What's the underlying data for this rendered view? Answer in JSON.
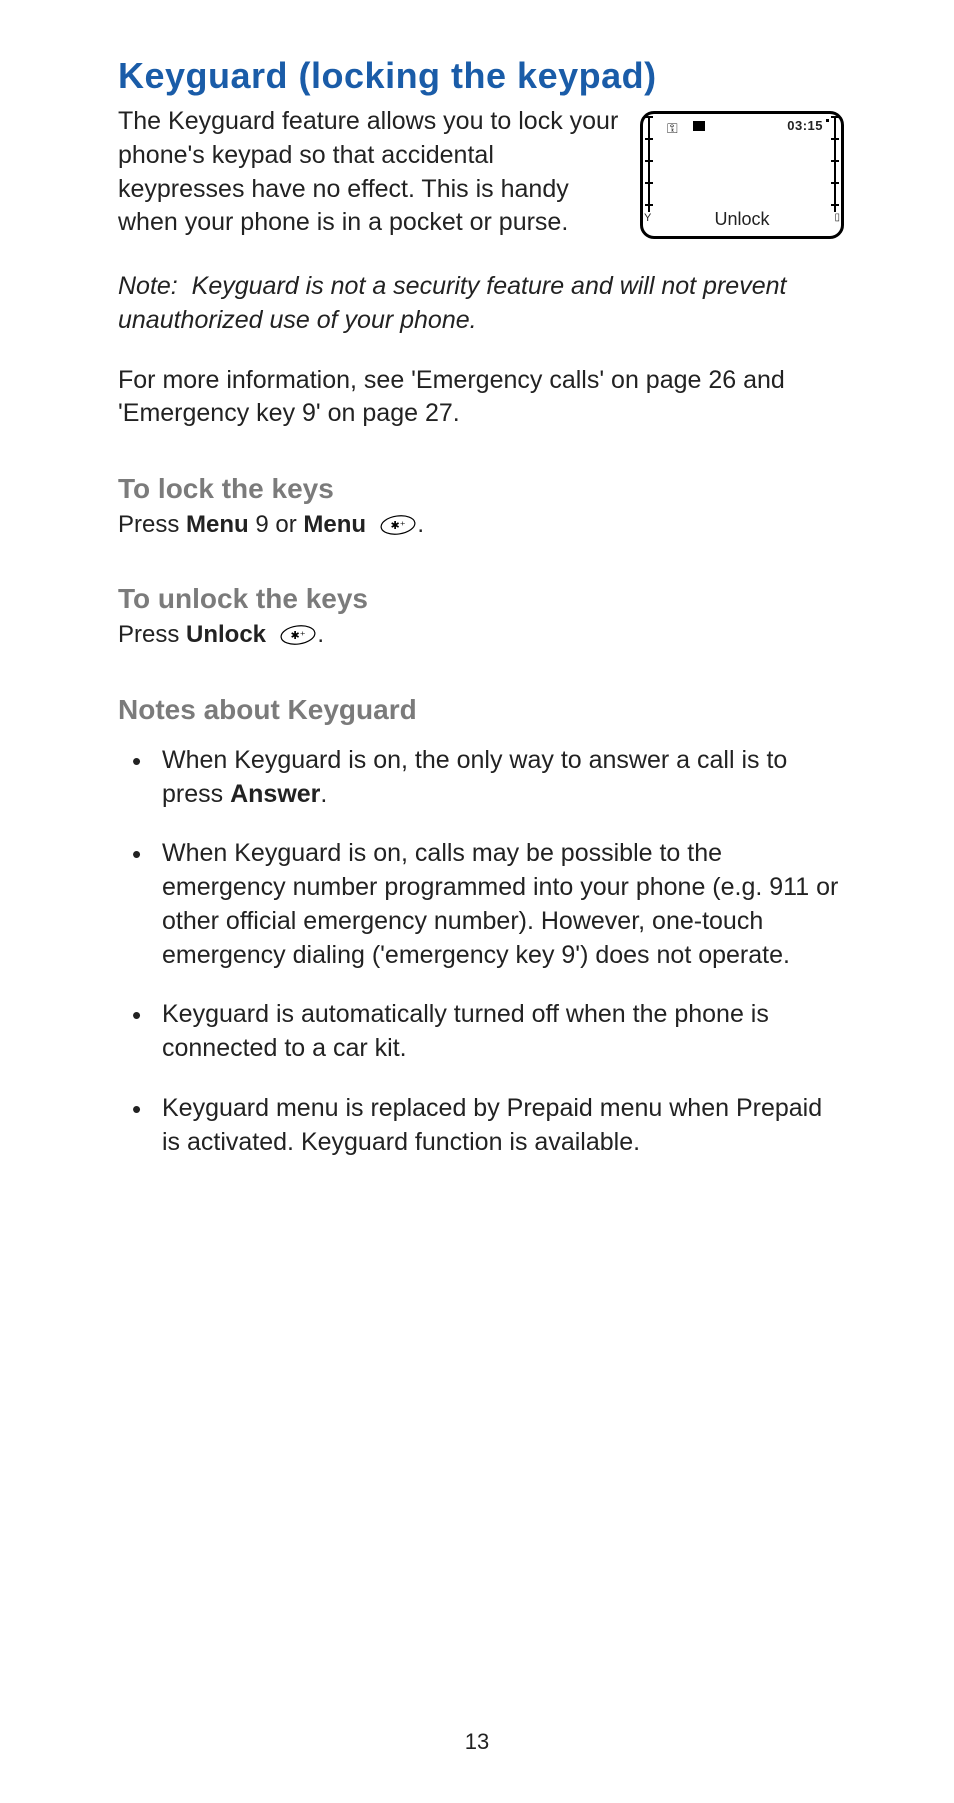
{
  "title": "Keyguard (locking the keypad)",
  "intro": "The Keyguard feature allows you to lock your phone's keypad so that accidental keypresses have no effect. This is handy when your phone is in a pocket or purse.",
  "phone": {
    "time": "03:15",
    "softkey": "Unlock"
  },
  "note_label": "Note:",
  "note_text": "Keyguard is not a security feature and will not prevent unauthorized use of your phone.",
  "crossref": "For more information, see 'Emergency calls' on page 26 and 'Emergency key 9' on page 27.",
  "lock": {
    "heading": "To lock the keys",
    "press": "Press ",
    "menu": "Menu",
    "nine_or": " 9 or ",
    "period": "."
  },
  "unlock": {
    "heading": "To unlock the keys",
    "press": "Press ",
    "unlock": "Unlock",
    "period": "."
  },
  "notes_heading": "Notes about Keyguard",
  "bullets": [
    {
      "pre": "When Keyguard is on, the only way to answer a call is to press ",
      "bold": "Answer",
      "post": "."
    },
    {
      "pre": "When Keyguard is on, calls may be possible to the emergency number programmed into your phone (e.g. 911 or other official emergency number). However, one-touch emergency dialing ('emergency key 9') does not operate.",
      "bold": "",
      "post": ""
    },
    {
      "pre": "Keyguard is automatically turned off when the phone is connected to a car kit.",
      "bold": "",
      "post": ""
    },
    {
      "pre": "Keyguard menu is replaced by Prepaid menu when Prepaid is activated. Keyguard function is available.",
      "bold": "",
      "post": ""
    }
  ],
  "page_number": "13",
  "star_key_glyph": "✱⁺"
}
